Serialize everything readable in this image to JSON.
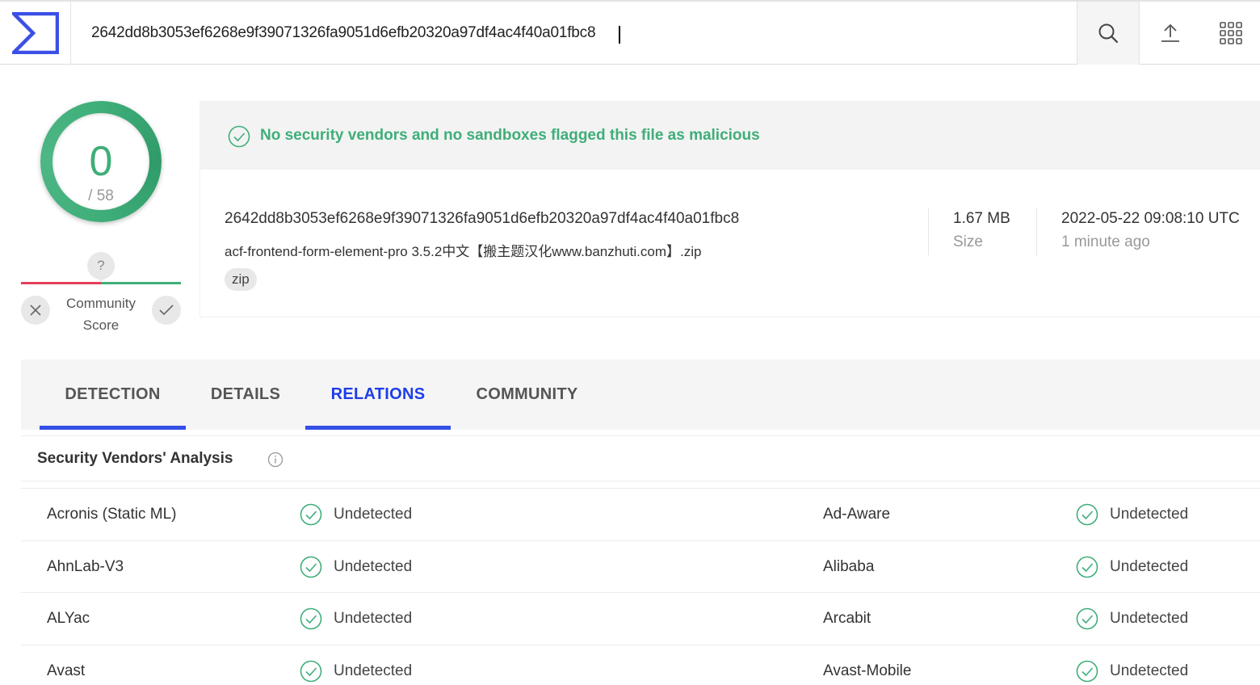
{
  "search": {
    "value": "2642dd8b3053ef6268e9f39071326fa9051d6efb20320a97df4ac4f40a01fbc8"
  },
  "score": {
    "detections": "0",
    "total": "/ 58"
  },
  "community": {
    "question": "?",
    "label_line1": "Community",
    "label_line2": "Score"
  },
  "verdict": {
    "text": "No security vendors and no sandboxes flagged this file as malicious"
  },
  "file": {
    "hash": "2642dd8b3053ef6268e9f39071326fa9051d6efb20320a97df4ac4f40a01fbc8",
    "name": "acf-frontend-form-element-pro 3.5.2中文【搬主题汉化www.banzhuti.com】.zip",
    "tag": "zip",
    "size": "1.67 MB",
    "size_label": "Size",
    "date": "2022-05-22 09:08:10 UTC",
    "date_label": "1 minute ago"
  },
  "tabs": [
    {
      "label": "DETECTION"
    },
    {
      "label": "DETAILS"
    },
    {
      "label": "RELATIONS"
    },
    {
      "label": "COMMUNITY"
    }
  ],
  "section": {
    "title": "Security Vendors' Analysis"
  },
  "vendors": [
    {
      "left_name": "Acronis (Static ML)",
      "left_status": "Undetected",
      "right_name": "Ad-Aware",
      "right_status": "Undetected"
    },
    {
      "left_name": "AhnLab-V3",
      "left_status": "Undetected",
      "right_name": "Alibaba",
      "right_status": "Undetected"
    },
    {
      "left_name": "ALYac",
      "left_status": "Undetected",
      "right_name": "Arcabit",
      "right_status": "Undetected"
    },
    {
      "left_name": "Avast",
      "left_status": "Undetected",
      "right_name": "Avast-Mobile",
      "right_status": "Undetected"
    }
  ],
  "colors": {
    "accent_blue": "#3550e6",
    "clean_green": "#3fae79",
    "negative_red": "#e23f5c"
  },
  "icons": {
    "logo": "sigma-logo-icon",
    "search": "search-icon",
    "upload": "upload-icon",
    "apps": "apps-grid-icon",
    "verdict": "check-circle-icon",
    "info": "info-icon"
  }
}
